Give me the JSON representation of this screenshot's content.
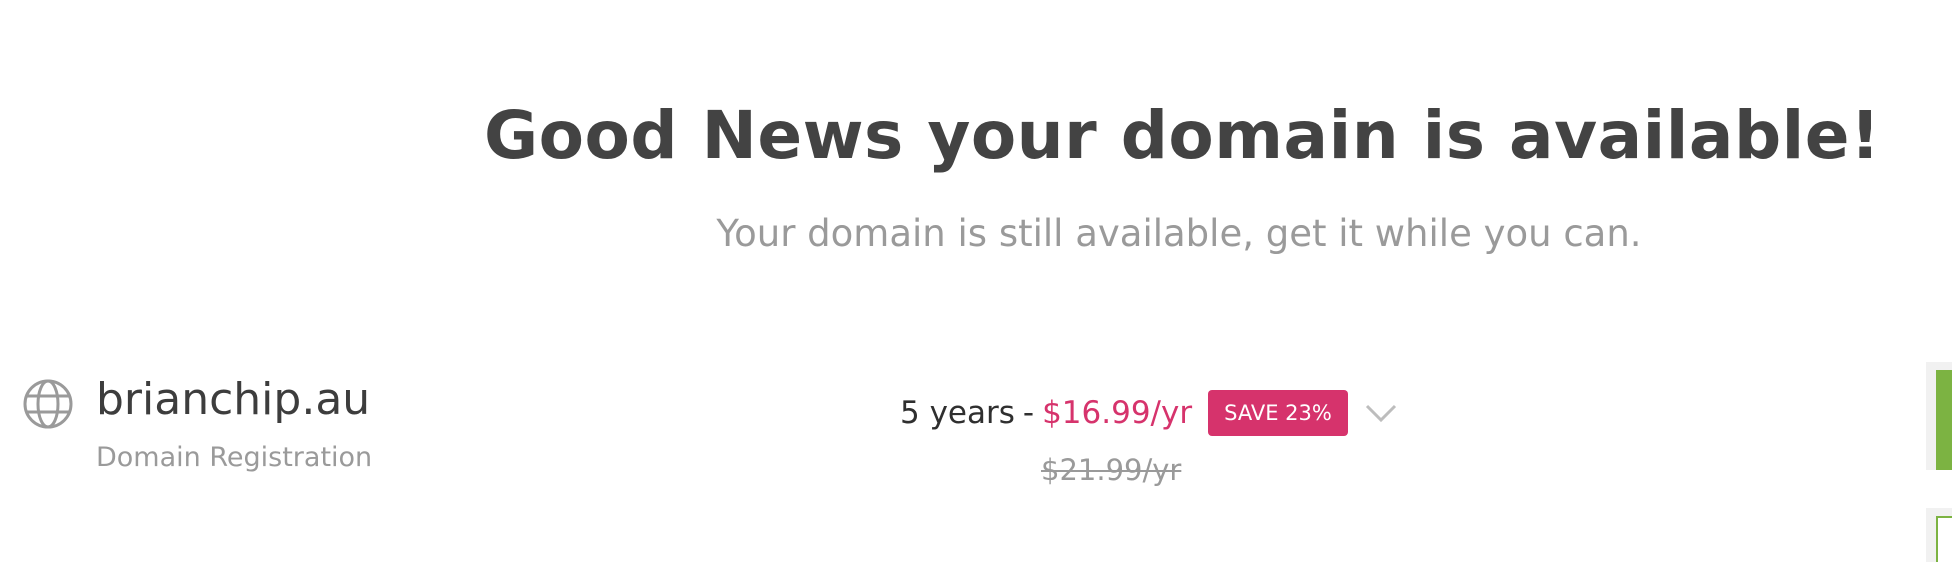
{
  "header": {
    "headline": "Good News your domain is available!",
    "subline": "Your domain is still available, get it while you can."
  },
  "result": {
    "icon": "globe-icon",
    "domain": "brianchip.au",
    "product": "Domain Registration",
    "term": "5 years",
    "separator": "-",
    "price": "$16.99/yr",
    "badge": "SAVE 23%",
    "original_price": "$21.99/yr"
  },
  "colors": {
    "headline": "#434343",
    "muted": "#9a9a9a",
    "accent": "#d6336c",
    "action": "#7cb342"
  }
}
